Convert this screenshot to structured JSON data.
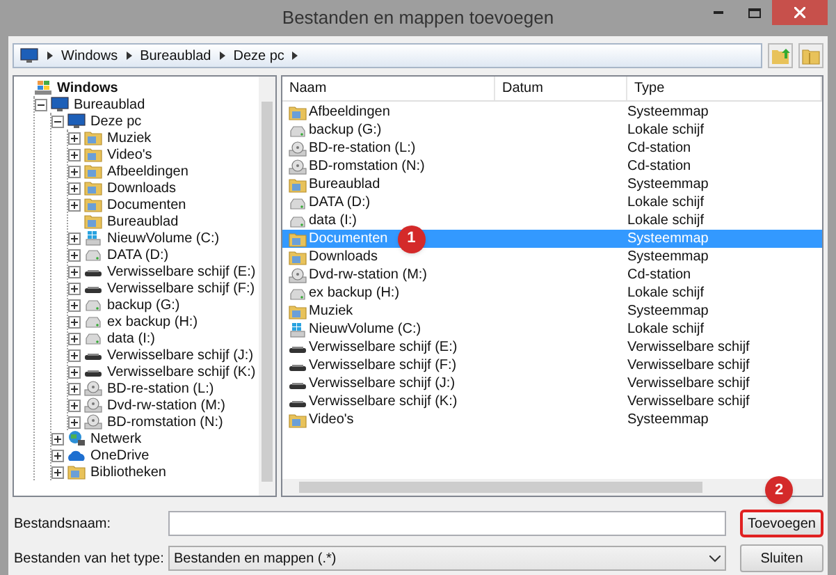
{
  "window": {
    "title": "Bestanden en mappen toevoegen"
  },
  "address_bar": {
    "crumbs": [
      "Windows",
      "Bureaublad",
      "Deze pc"
    ]
  },
  "tree": [
    {
      "label": "Windows",
      "kind": "windows",
      "children": [
        {
          "label": "Bureaublad",
          "kind": "desktop",
          "expanded": true,
          "children": [
            {
              "label": "Deze pc",
              "kind": "computer",
              "expanded": true,
              "children": [
                {
                  "label": "Muziek",
                  "kind": "folder",
                  "expanded": false
                },
                {
                  "label": "Video's",
                  "kind": "folder",
                  "expanded": false
                },
                {
                  "label": "Afbeeldingen",
                  "kind": "folder",
                  "expanded": false
                },
                {
                  "label": "Downloads",
                  "kind": "folder",
                  "expanded": false
                },
                {
                  "label": "Documenten",
                  "kind": "folder",
                  "expanded": false
                },
                {
                  "label": "Bureaublad",
                  "kind": "folder"
                },
                {
                  "label": "NieuwVolume (C:)",
                  "kind": "system-drive",
                  "expanded": false
                },
                {
                  "label": "DATA (D:)",
                  "kind": "drive",
                  "expanded": false
                },
                {
                  "label": "Verwisselbare schijf (E:)",
                  "kind": "removable",
                  "expanded": false
                },
                {
                  "label": "Verwisselbare schijf (F:)",
                  "kind": "removable",
                  "expanded": false
                },
                {
                  "label": "backup (G:)",
                  "kind": "drive",
                  "expanded": false
                },
                {
                  "label": "ex backup (H:)",
                  "kind": "drive",
                  "expanded": false
                },
                {
                  "label": "data (I:)",
                  "kind": "drive",
                  "expanded": false
                },
                {
                  "label": "Verwisselbare schijf (J:)",
                  "kind": "removable",
                  "expanded": false
                },
                {
                  "label": "Verwisselbare schijf (K:)",
                  "kind": "removable",
                  "expanded": false
                },
                {
                  "label": "BD-re-station (L:)",
                  "kind": "optical",
                  "expanded": false
                },
                {
                  "label": "Dvd-rw-station (M:)",
                  "kind": "optical",
                  "expanded": false
                },
                {
                  "label": "BD-romstation (N:)",
                  "kind": "optical",
                  "expanded": false
                }
              ]
            },
            {
              "label": "Netwerk",
              "kind": "network",
              "expanded": false
            },
            {
              "label": "OneDrive",
              "kind": "cloud",
              "expanded": false
            },
            {
              "label": "Bibliotheken",
              "kind": "folder",
              "expanded": false
            }
          ]
        }
      ]
    }
  ],
  "table": {
    "columns": [
      "Naam",
      "Datum",
      "Type"
    ],
    "rows": [
      {
        "name": "Afbeeldingen",
        "type": "Systeemmap",
        "kind": "folder",
        "selected": false
      },
      {
        "name": "backup (G:)",
        "type": "Lokale schijf",
        "kind": "drive",
        "selected": false
      },
      {
        "name": "BD-re-station (L:)",
        "type": "Cd-station",
        "kind": "optical",
        "selected": false
      },
      {
        "name": "BD-romstation (N:)",
        "type": "Cd-station",
        "kind": "optical",
        "selected": false
      },
      {
        "name": "Bureaublad",
        "type": "Systeemmap",
        "kind": "folder",
        "selected": false
      },
      {
        "name": "DATA (D:)",
        "type": "Lokale schijf",
        "kind": "drive",
        "selected": false
      },
      {
        "name": "data (I:)",
        "type": "Lokale schijf",
        "kind": "drive",
        "selected": false
      },
      {
        "name": "Documenten",
        "type": "Systeemmap",
        "kind": "folder",
        "selected": true
      },
      {
        "name": "Downloads",
        "type": "Systeemmap",
        "kind": "folder",
        "selected": false
      },
      {
        "name": "Dvd-rw-station (M:)",
        "type": "Cd-station",
        "kind": "optical",
        "selected": false
      },
      {
        "name": "ex backup (H:)",
        "type": "Lokale schijf",
        "kind": "drive",
        "selected": false
      },
      {
        "name": "Muziek",
        "type": "Systeemmap",
        "kind": "folder",
        "selected": false
      },
      {
        "name": "NieuwVolume (C:)",
        "type": "Lokale schijf",
        "kind": "system-drive",
        "selected": false
      },
      {
        "name": "Verwisselbare schijf (E:)",
        "type": "Verwisselbare schijf",
        "kind": "removable",
        "selected": false
      },
      {
        "name": "Verwisselbare schijf (F:)",
        "type": "Verwisselbare schijf",
        "kind": "removable",
        "selected": false
      },
      {
        "name": "Verwisselbare schijf (J:)",
        "type": "Verwisselbare schijf",
        "kind": "removable",
        "selected": false
      },
      {
        "name": "Verwisselbare schijf (K:)",
        "type": "Verwisselbare schijf",
        "kind": "removable",
        "selected": false
      },
      {
        "name": "Video's",
        "type": "Systeemmap",
        "kind": "folder",
        "selected": false
      }
    ]
  },
  "filename": {
    "label": "Bestandsnaam:"
  },
  "filetype": {
    "label": "Bestanden van het type:",
    "value": "Bestanden en mappen (.*)"
  },
  "buttons": [
    "Toevoegen",
    "Sluiten"
  ],
  "annotations": [
    {
      "label": "1"
    },
    {
      "label": "2"
    }
  ]
}
